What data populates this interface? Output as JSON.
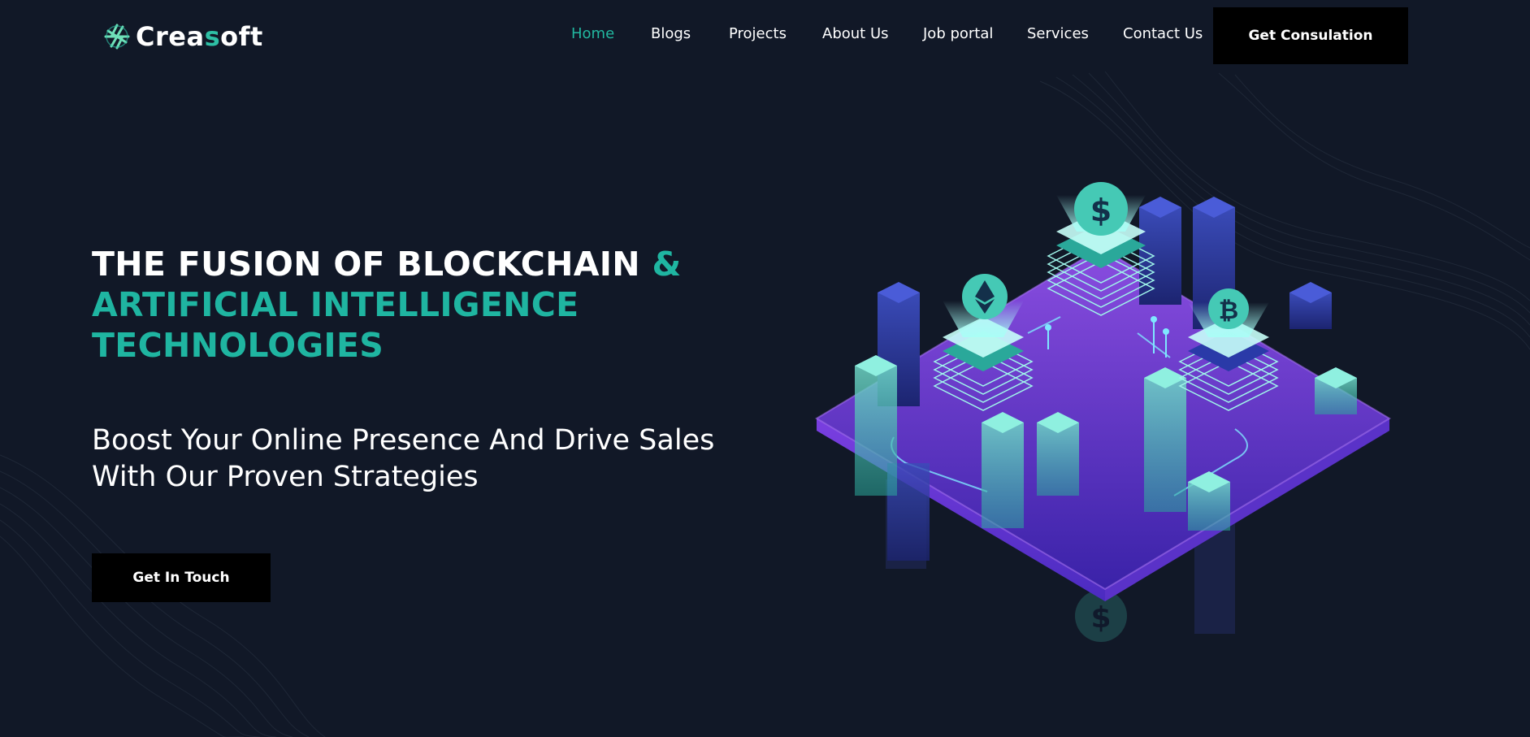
{
  "brand": {
    "name_part1": "Crea",
    "name_accent": "s",
    "name_part2": "oft",
    "accent_color": "#2ebfa5"
  },
  "nav": {
    "items": [
      {
        "label": "Home",
        "active": true
      },
      {
        "label": "Blogs"
      },
      {
        "label": "Projects"
      },
      {
        "label": "About Us"
      },
      {
        "label": "Job portal"
      },
      {
        "label": "Services"
      },
      {
        "label": "Contact Us"
      }
    ],
    "cta_label": "Get Consulation"
  },
  "hero": {
    "title_line1": "THE FUSION OF BLOCKCHAIN",
    "title_amp": "&",
    "title_line2": "ARTIFICIAL INTELLIGENCE",
    "title_line3": "TECHNOLOGIES",
    "subtitle_line1": "Boost Your Online Presence And Drive Sales",
    "subtitle_line2": "With Our Proven Strategies",
    "cta_label": "Get In Touch"
  },
  "illustration": {
    "coin_dollar": "$",
    "coin_bitcoin": "₿",
    "coin_dollar_reflection": "$"
  },
  "colors": {
    "background": "#111827",
    "teal": "#1fb5a1",
    "purple": "#6a3ad0",
    "button": "#000000"
  }
}
